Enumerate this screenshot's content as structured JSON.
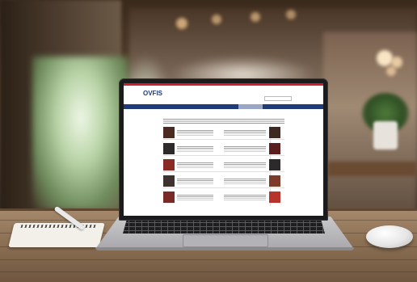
{
  "website": {
    "logo": "OVFIS",
    "tagline": "",
    "nav_items": [],
    "page_heading": "",
    "cards_left": [
      {
        "title": ""
      },
      {
        "title": ""
      },
      {
        "title": ""
      },
      {
        "title": ""
      },
      {
        "title": ""
      }
    ],
    "cards_right": [
      {
        "title": ""
      },
      {
        "title": ""
      },
      {
        "title": ""
      },
      {
        "title": ""
      },
      {
        "title": ""
      }
    ]
  },
  "colors": {
    "site_blue": "#1f3b79",
    "site_red": "#c8202f",
    "table_wood": "#8f7357"
  },
  "objects": [
    "laptop",
    "spiral-notebook",
    "pen",
    "computer-mouse",
    "wooden-table",
    "blurred-cafe-background"
  ]
}
